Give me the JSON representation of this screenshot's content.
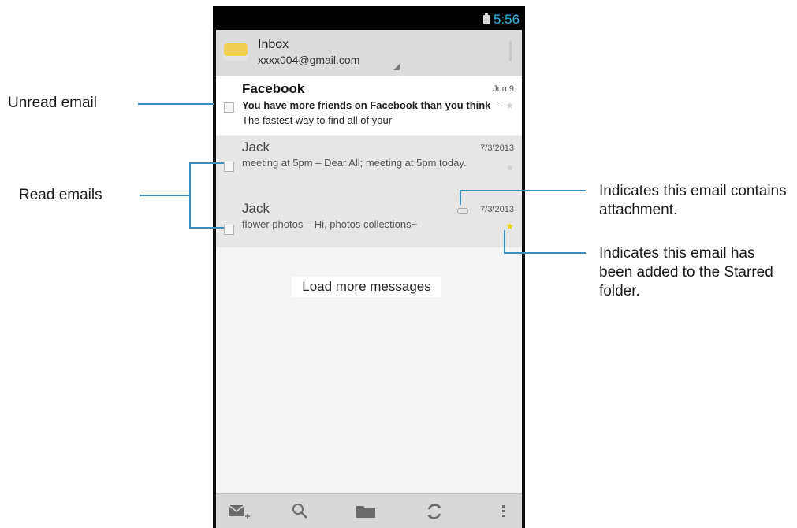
{
  "status_bar": {
    "time": "5:56"
  },
  "header": {
    "title": "Inbox",
    "account": "xxxx004@gmail.com"
  },
  "emails": [
    {
      "sender": "Facebook",
      "date": "Jun 9",
      "subject": "You have more friends on Facebook than you think",
      "preview": "The fastest way to find all of your",
      "unread": true,
      "starred": false,
      "has_attachment": false
    },
    {
      "sender": "Jack",
      "date": "7/3/2013",
      "subject": "meeting at 5pm",
      "preview": "Dear All; meeting at 5pm today.",
      "unread": false,
      "starred": false,
      "has_attachment": false
    },
    {
      "sender": "Jack",
      "date": "7/3/2013",
      "subject": "flower photos",
      "preview": "Hi, photos collections~",
      "unread": false,
      "starred": true,
      "has_attachment": true
    }
  ],
  "load_more_label": "Load more messages",
  "toolbar_icons": [
    "compose-icon",
    "search-icon",
    "folder-icon",
    "refresh-icon",
    "overflow-menu-icon"
  ],
  "callouts": {
    "unread": "Unread email",
    "read": "Read emails",
    "attachment": "Indicates this email contains attachment.",
    "starred": "Indicates this email has been added to the Starred folder."
  },
  "colors": {
    "accent": "#33b5e5",
    "callout_line": "#3b8fbe",
    "star": "#e6d600"
  }
}
